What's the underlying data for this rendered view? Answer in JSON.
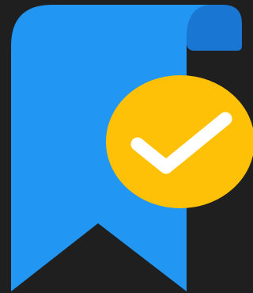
{
  "icon": {
    "name": "bookmark-added-icon",
    "colors": {
      "background": "#1f1f1f",
      "bookmark": "#2196f3",
      "bookmark_fold": "#1976d2",
      "badge": "#ffc107",
      "check": "#ffffff"
    }
  }
}
